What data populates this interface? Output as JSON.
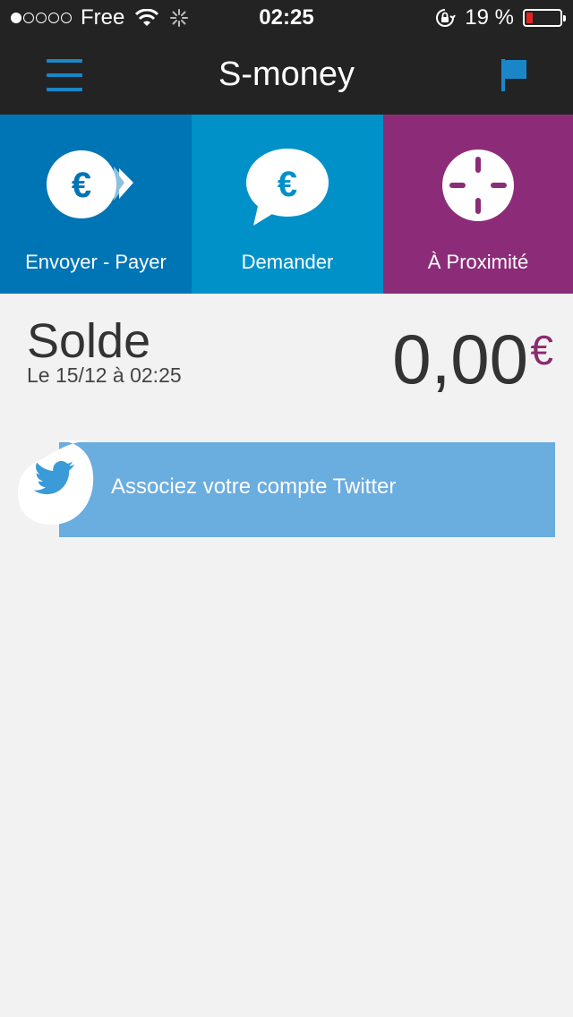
{
  "status_bar": {
    "carrier": "Free",
    "time": "02:25",
    "battery_percent": "19 %",
    "battery_level": 0.19,
    "signal_bars": 1,
    "signal_total": 5
  },
  "nav": {
    "title": "S-money"
  },
  "actions": [
    {
      "label": "Envoyer - Payer",
      "color": "#0075b5"
    },
    {
      "label": "Demander",
      "color": "#0091c9"
    },
    {
      "label": "À Proximité",
      "color": "#8c2c78"
    }
  ],
  "balance": {
    "title": "Solde",
    "date": "Le 15/12 à 02:25",
    "amount": "0,00",
    "currency": "€"
  },
  "twitter": {
    "label": "Associez votre compte Twitter"
  },
  "colors": {
    "dark_bar": "#232323",
    "accent_blue": "#1a86c8",
    "twitter_blue": "#6aaddf",
    "purple": "#8b2a6f"
  },
  "icons": {
    "euro_symbol": "€"
  }
}
